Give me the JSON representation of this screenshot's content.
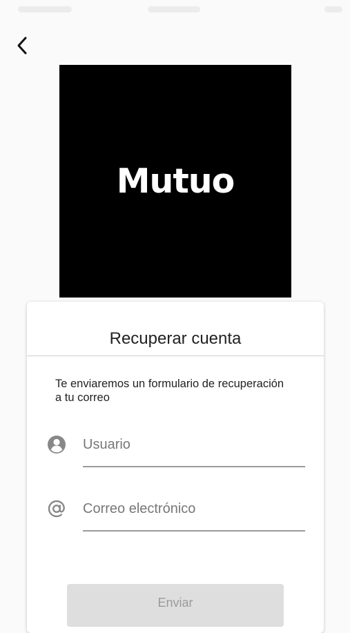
{
  "app": {
    "logo_text": "Mutuo"
  },
  "nav": {
    "back_icon": "chevron-left-icon"
  },
  "card": {
    "title": "Recuperar cuenta",
    "description": "Te enviaremos un formulario de recuperación a tu correo",
    "fields": [
      {
        "icon": "user-circle-icon",
        "placeholder": "Usuario",
        "value": ""
      },
      {
        "icon": "at-sign-icon",
        "placeholder": "Correo electrónico",
        "value": ""
      }
    ],
    "submit_label": "Enviar"
  },
  "colors": {
    "background": "#fafafa",
    "logo_bg": "#000000",
    "logo_text": "#ffffff",
    "button_disabled_bg": "#dedede",
    "button_disabled_text": "#9a9a9a",
    "icon_gray": "#888888"
  }
}
